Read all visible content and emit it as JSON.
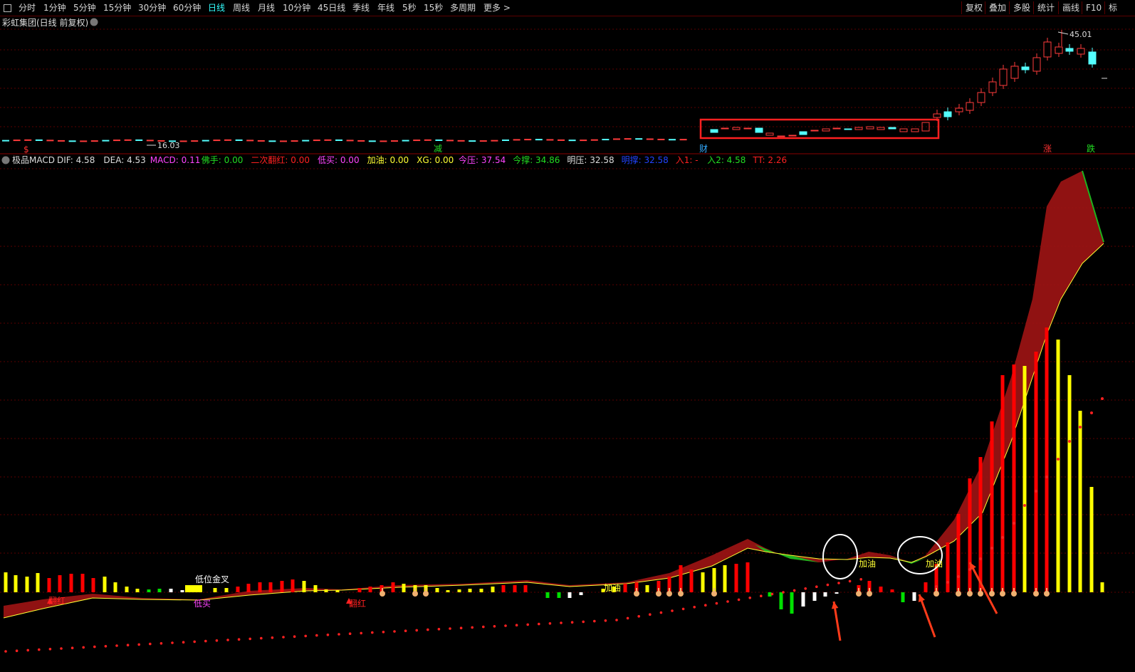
{
  "toolbar": {
    "period_tabs": [
      {
        "label": "分时",
        "active": false
      },
      {
        "label": "1分钟",
        "active": false
      },
      {
        "label": "5分钟",
        "active": false
      },
      {
        "label": "15分钟",
        "active": false
      },
      {
        "label": "30分钟",
        "active": false
      },
      {
        "label": "60分钟",
        "active": false
      },
      {
        "label": "日线",
        "active": true
      },
      {
        "label": "周线",
        "active": false
      },
      {
        "label": "月线",
        "active": false
      },
      {
        "label": "10分钟",
        "active": false
      },
      {
        "label": "45日线",
        "active": false
      },
      {
        "label": "季线",
        "active": false
      },
      {
        "label": "年线",
        "active": false
      },
      {
        "label": "5秒",
        "active": false
      },
      {
        "label": "15秒",
        "active": false
      },
      {
        "label": "多周期",
        "active": false
      },
      {
        "label": "更多 >",
        "active": false
      }
    ],
    "right_buttons": [
      "复权",
      "叠加",
      "多股",
      "统计",
      "画线",
      "F10",
      "标"
    ]
  },
  "price_panel": {
    "title": "彩虹集团(日线 前复权)",
    "high_label": "45.01",
    "low_label": "16.03",
    "markers": [
      {
        "text": "$",
        "color": "#ff3030"
      },
      {
        "text": "减",
        "color": "#22dd22"
      },
      {
        "text": "财",
        "color": "#33aaff"
      },
      {
        "text": "涨",
        "color": "#ff3030"
      },
      {
        "text": "跌",
        "color": "#22dd22"
      }
    ]
  },
  "indicator_panel": {
    "name": "极品MACD",
    "values": [
      {
        "label": "DIF: 4.58",
        "color": "#dddddd"
      },
      {
        "label": "DEA: 4.53",
        "color": "#dddddd"
      },
      {
        "label": "MACD: 0.11",
        "color": "#ff44ff"
      },
      {
        "label": "佛手: 0.00",
        "color": "#22dd22"
      },
      {
        "label": "二次翻红: 0.00",
        "color": "#ff2020"
      },
      {
        "label": "低买: 0.00",
        "color": "#ff44ff"
      },
      {
        "label": "加油: 0.00",
        "color": "#ffff33"
      },
      {
        "label": "XG: 0.00",
        "color": "#ffff33"
      },
      {
        "label": "今压: 37.54",
        "color": "#ff44ff"
      },
      {
        "label": "今撑: 34.86",
        "color": "#22dd22"
      },
      {
        "label": "明压: 32.58",
        "color": "#dddddd"
      },
      {
        "label": "明撑: 32.58",
        "color": "#2244ff"
      },
      {
        "label": "入1: -",
        "color": "#ff2020"
      },
      {
        "label": "入2: 4.58",
        "color": "#22dd22"
      },
      {
        "label": "TT: 2.26",
        "color": "#ff2020"
      }
    ],
    "signals": [
      {
        "text": "低位金叉",
        "color": "#ffffff"
      },
      {
        "text": "低买",
        "color": "#ff44ff"
      },
      {
        "text": "翻红",
        "color": "#ff2020"
      },
      {
        "text": "翻红",
        "color": "#ff2020"
      },
      {
        "text": "加油",
        "color": "#ffff33"
      },
      {
        "text": "加油",
        "color": "#ffff33"
      },
      {
        "text": "加油",
        "color": "#ffff33"
      }
    ]
  },
  "colors": {
    "up": "#ff3b3b",
    "down": "#54ffff",
    "grid": "#5a0000",
    "band_up": "#a01414",
    "band_down": "#1db21d",
    "bar_red": "#ff0000",
    "bar_yellow": "#ffff00",
    "bar_green": "#00e000",
    "bar_white": "#ffffff"
  }
}
